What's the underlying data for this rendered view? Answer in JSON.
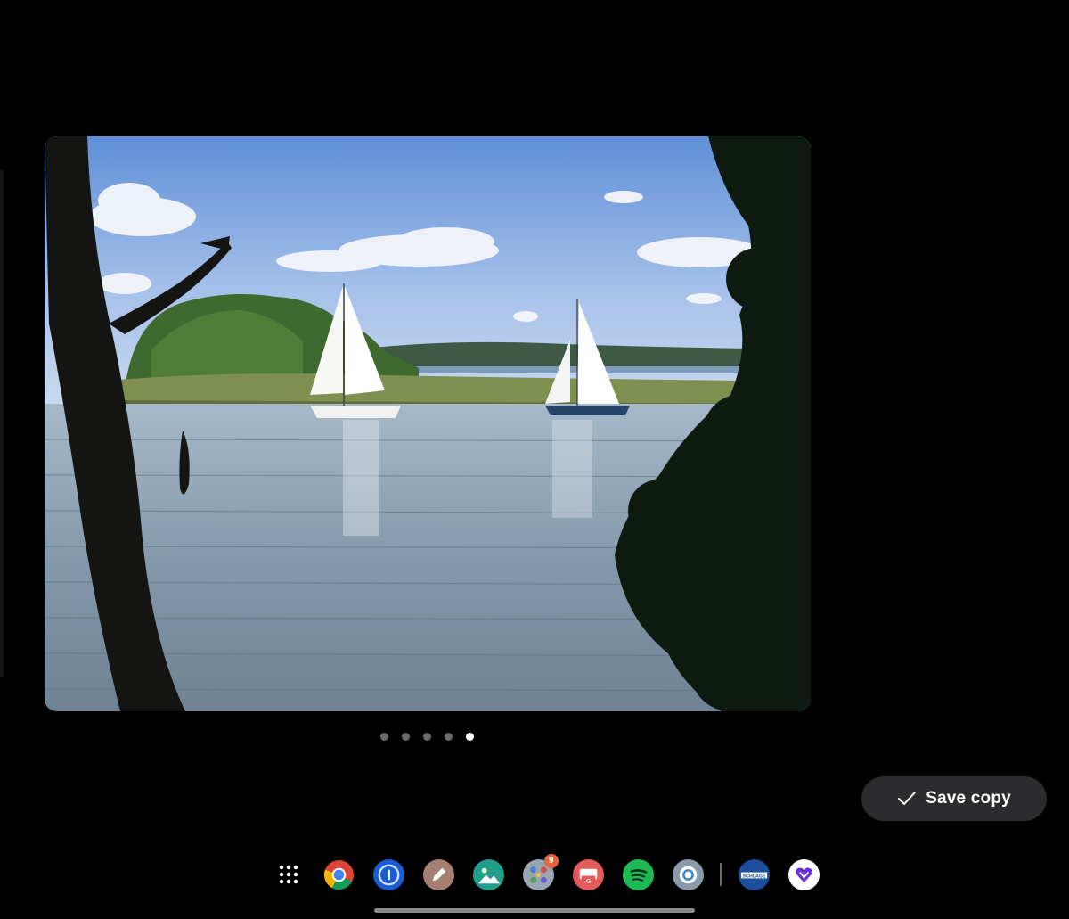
{
  "viewer": {
    "page_count": 5,
    "active_page": 5
  },
  "actions": {
    "save_copy_label": "Save copy"
  },
  "dock": {
    "apps": [
      {
        "name": "app-launcher-icon"
      },
      {
        "name": "chrome-icon"
      },
      {
        "name": "password-manager-icon"
      },
      {
        "name": "sketch-pen-icon"
      },
      {
        "name": "photos-icon"
      },
      {
        "name": "app-folder-icon",
        "badge": "9"
      },
      {
        "name": "google-news-icon"
      },
      {
        "name": "spotify-icon"
      },
      {
        "name": "camera-icon"
      },
      {
        "name": "schlage-icon",
        "label": "SCHLAGE"
      },
      {
        "name": "heart-app-icon"
      }
    ]
  },
  "colors": {
    "background": "#000000",
    "button_bg": "#2c2c2e",
    "badge": "#e8643c"
  }
}
